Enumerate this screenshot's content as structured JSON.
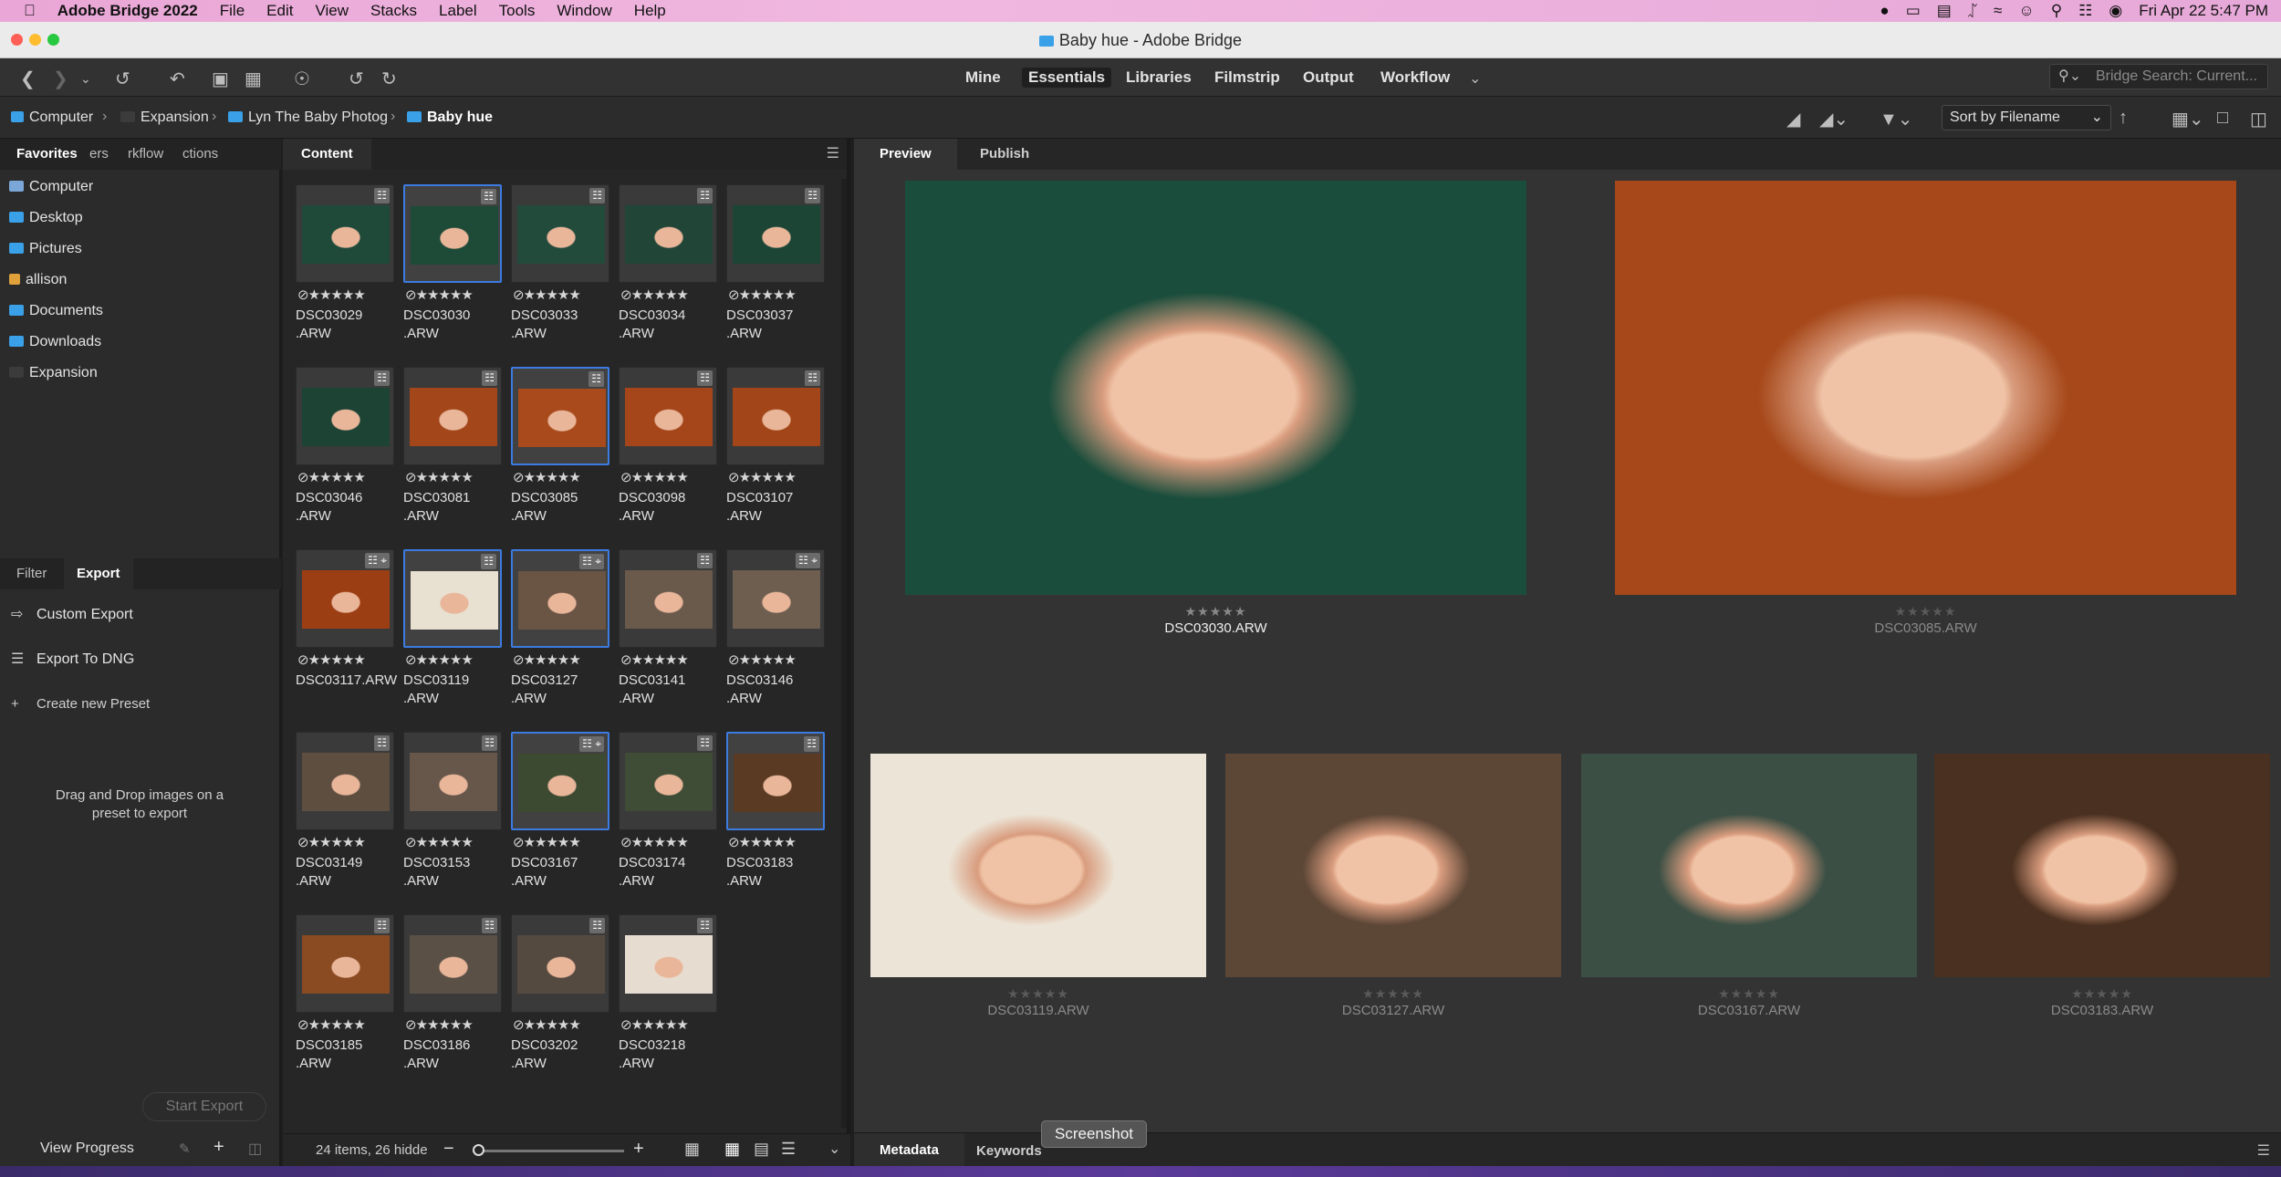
{
  "menubar": {
    "app_name": "Adobe Bridge 2022",
    "items": [
      "File",
      "Edit",
      "View",
      "Stacks",
      "Label",
      "Tools",
      "Window",
      "Help"
    ],
    "datetime": "Fri Apr 22  5:47 PM"
  },
  "window": {
    "title": "Baby hue - Adobe Bridge"
  },
  "workspaces": {
    "items": [
      "Mine",
      "Essentials",
      "Libraries",
      "Filmstrip",
      "Output",
      "Workflow"
    ],
    "active": "Essentials"
  },
  "search": {
    "placeholder": "Bridge Search: Current..."
  },
  "path": {
    "crumbs": [
      "Computer",
      "Expansion",
      "Lyn The Baby Photog",
      "Baby hue"
    ]
  },
  "sort": {
    "label": "Sort by Filename"
  },
  "left_panel": {
    "tabs": [
      "Favorites",
      "ers",
      "rkflow",
      "ctions"
    ],
    "favorites": [
      {
        "label": "Computer",
        "icon": "computer-icon"
      },
      {
        "label": "Desktop",
        "icon": "folder-icon"
      },
      {
        "label": "Pictures",
        "icon": "folder-icon"
      },
      {
        "label": "allison",
        "icon": "home-icon"
      },
      {
        "label": "Documents",
        "icon": "folder-icon"
      },
      {
        "label": "Downloads",
        "icon": "folder-icon"
      },
      {
        "label": "Expansion",
        "icon": "drive-icon"
      }
    ],
    "lower_tabs": [
      "Filter",
      "Export"
    ],
    "export_items": [
      "Custom Export",
      "Export To DNG",
      "Create new Preset"
    ],
    "drop_hint": "Drag and Drop images on a preset to export",
    "start_export": "Start Export",
    "view_progress": "View Progress"
  },
  "content": {
    "tab": "Content",
    "status": "24 items, 26 hidde",
    "items": [
      {
        "name1": "DSC03029",
        "name2": ".ARW",
        "color": "#1f4a3a",
        "sel": false,
        "crop": false
      },
      {
        "name1": "DSC03030",
        "name2": ".ARW",
        "color": "#1e4a38",
        "sel": true,
        "crop": false
      },
      {
        "name1": "DSC03033",
        "name2": ".ARW",
        "color": "#234b3c",
        "sel": false,
        "crop": false
      },
      {
        "name1": "DSC03034",
        "name2": ".ARW",
        "color": "#214638",
        "sel": false,
        "crop": false
      },
      {
        "name1": "DSC03037",
        "name2": ".ARW",
        "color": "#1c4536",
        "sel": false,
        "crop": false
      },
      {
        "name1": "DSC03046",
        "name2": ".ARW",
        "color": "#1d4334",
        "sel": false,
        "crop": false
      },
      {
        "name1": "DSC03081",
        "name2": ".ARW",
        "color": "#a3471a",
        "sel": false,
        "crop": false
      },
      {
        "name1": "DSC03085",
        "name2": ".ARW",
        "color": "#a84a1c",
        "sel": true,
        "crop": false
      },
      {
        "name1": "DSC03098",
        "name2": ".ARW",
        "color": "#a5461a",
        "sel": false,
        "crop": false
      },
      {
        "name1": "DSC03107",
        "name2": ".ARW",
        "color": "#a24518",
        "sel": false,
        "crop": false
      },
      {
        "name1": "DSC03117.ARW",
        "name2": "",
        "color": "#9c3e14",
        "sel": false,
        "crop": true
      },
      {
        "name1": "DSC03119",
        "name2": ".ARW",
        "color": "#e8e1d2",
        "sel": true,
        "crop": false
      },
      {
        "name1": "DSC03127",
        "name2": ".ARW",
        "color": "#6a5444",
        "sel": true,
        "crop": true
      },
      {
        "name1": "DSC03141",
        "name2": ".ARW",
        "color": "#6a5a4c",
        "sel": false,
        "crop": false
      },
      {
        "name1": "DSC03146",
        "name2": ".ARW",
        "color": "#6e5e50",
        "sel": false,
        "crop": true
      },
      {
        "name1": "DSC03149",
        "name2": ".ARW",
        "color": "#5e4e40",
        "sel": false,
        "crop": false
      },
      {
        "name1": "DSC03153",
        "name2": ".ARW",
        "color": "#66574a",
        "sel": false,
        "crop": false
      },
      {
        "name1": "DSC03167",
        "name2": ".ARW",
        "color": "#3d4a32",
        "sel": true,
        "crop": true
      },
      {
        "name1": "DSC03174",
        "name2": ".ARW",
        "color": "#3f4c36",
        "sel": false,
        "crop": false
      },
      {
        "name1": "DSC03183",
        "name2": ".ARW",
        "color": "#5a3a22",
        "sel": true,
        "crop": false
      },
      {
        "name1": "DSC03185",
        "name2": ".ARW",
        "color": "#8a4a22",
        "sel": false,
        "crop": false
      },
      {
        "name1": "DSC03186",
        "name2": ".ARW",
        "color": "#5a5046",
        "sel": false,
        "crop": false
      },
      {
        "name1": "DSC03202",
        "name2": ".ARW",
        "color": "#554a40",
        "sel": false,
        "crop": false
      },
      {
        "name1": "DSC03218",
        "name2": ".ARW",
        "color": "#e6ddd0",
        "sel": false,
        "crop": false
      }
    ]
  },
  "preview": {
    "tabs": [
      "Preview",
      "Publish"
    ],
    "images": [
      {
        "label": "DSC03030.ARW",
        "color": "#1a4d3c",
        "active": true
      },
      {
        "label": "DSC03085.ARW",
        "color": "#a6481a",
        "active": false
      },
      {
        "label": "DSC03119.ARW",
        "color": "#ece4d6",
        "active": false
      },
      {
        "label": "DSC03127.ARW",
        "color": "#5c4636",
        "active": false
      },
      {
        "label": "DSC03167.ARW",
        "color": "#3b4f44",
        "active": false
      },
      {
        "label": "DSC03183.ARW",
        "color": "#4a3020",
        "active": false
      }
    ]
  },
  "bottom": {
    "tabs": [
      "Metadata",
      "Keywords"
    ],
    "tooltip": "Screenshot"
  },
  "stars": "★★★★★"
}
